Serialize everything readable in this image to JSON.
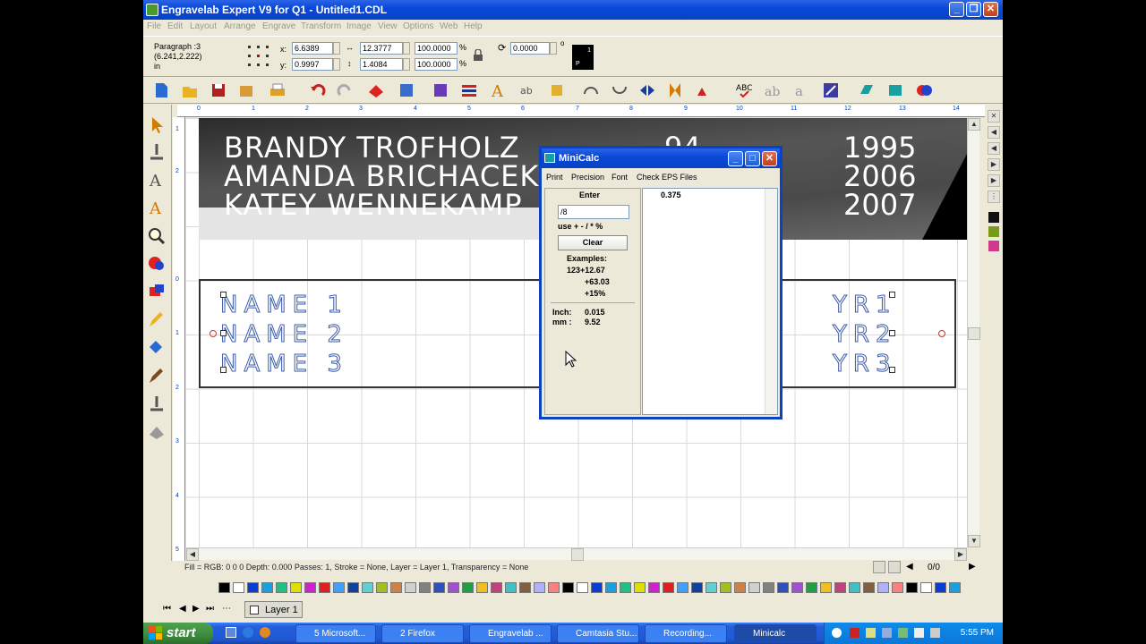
{
  "window": {
    "title": "Engravelab Expert V9 for Q1 - Untitled1.CDL"
  },
  "menu": [
    "File",
    "Edit",
    "Layout",
    "Arrange",
    "Engrave",
    "Transform",
    "Image",
    "View",
    "Options",
    "Web",
    "Help"
  ],
  "props": {
    "object_type": "Paragraph :3",
    "coords": "(6.241,2.222)",
    "units": "in",
    "x_label": "x:",
    "x_value": "6.6389",
    "y_label": "y:",
    "y_value": "0.9997",
    "width_value": "12.3777",
    "height_value": "1.4084",
    "scale_x": "100.0000",
    "scale_y": "100.0000",
    "rotation": "0.0000",
    "degree": "o",
    "pct": "%",
    "pen_top": "1",
    "pen_bottom": "P"
  },
  "ruler": {
    "h": [
      "0",
      "1",
      "2",
      "3",
      "4",
      "5",
      "6",
      "7",
      "8",
      "9",
      "10",
      "11",
      "12",
      "13",
      "14"
    ],
    "v": [
      "1",
      "2",
      "0",
      "1",
      "2",
      "3",
      "4",
      "5"
    ]
  },
  "photo": {
    "names": [
      "BRANDY TROFHOLZ",
      "AMANDA BRICHACEK",
      "KATEY WENNEKAMP"
    ],
    "years": [
      "1995",
      "2006",
      "2007"
    ],
    "partial": "94"
  },
  "plate": {
    "names": [
      "NAME 1",
      "NAME 2",
      "NAME 3"
    ],
    "years": [
      "YR1",
      "YR2",
      "YR3"
    ]
  },
  "status": {
    "text": "Fill = RGB: 0 0 0 Depth: 0.000 Passes: 1, Stroke = None, Layer = Layer 1, Transparency = None",
    "page": "0/0"
  },
  "layers": {
    "layer1": "Layer 1"
  },
  "minicalc": {
    "title": "MiniCalc",
    "menu": [
      "Print",
      "Precision",
      "Font",
      "Check EPS Files"
    ],
    "enter_label": "Enter",
    "input_value": "/8",
    "hint": "use + - / * %",
    "clear_label": "Clear",
    "examples_label": "Examples:",
    "examples": [
      "123+12.67",
      "+63.03",
      "+15%"
    ],
    "inch_label": "Inch:",
    "inch_value": "0.015",
    "mm_label": "mm :",
    "mm_value": "9.52",
    "result": "0.375"
  },
  "taskbar": {
    "start": "start",
    "buttons": [
      "5 Microsoft...",
      "2 Firefox",
      "Engravelab ...",
      "Camtasia Stu...",
      "Recording...",
      "Minicalc"
    ],
    "time": "5:55 PM"
  },
  "colors": {
    "accent": "#0a49d8",
    "plate_text": "#3b5aa8"
  }
}
